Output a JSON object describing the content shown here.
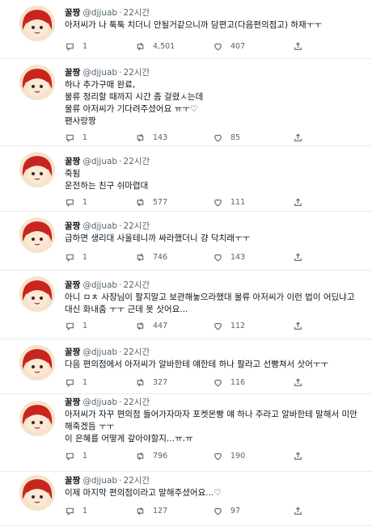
{
  "author": {
    "name": "꿀짱",
    "handle": "@djjuab",
    "time": "22시간"
  },
  "icons": {
    "reply": "reply-icon",
    "retweet": "retweet-icon",
    "like": "heart-icon",
    "share": "share-icon"
  },
  "colors": {
    "muted": "#536471",
    "divider": "#e6ecf0",
    "thread": "#cfd9de",
    "avatar_hair": "#c8251f"
  },
  "tweets": [
    {
      "text": "아저씨가 나 툭툭 치더니 안될거같으니까 담편고(다음편의점고) 하재ㅜㅜ",
      "replies": "1",
      "retweets": "4,501",
      "likes": "407"
    },
    {
      "text": "하나 추가구매 완료,\n물류 정리할 때까지 시간 좀 걸렸ㅅ는데\n물류 아저씨가 기다려주셨어요 ㅠㅜ♡\n팬사랑짱",
      "replies": "1",
      "retweets": "143",
      "likes": "85"
    },
    {
      "text": "죽됨\n운전하는 친구 쉬마렵대",
      "replies": "1",
      "retweets": "577",
      "likes": "111"
    },
    {
      "text": "급하면 생리대 사올테니까 싸라했더니 걍 닥치래ㅜㅜ",
      "replies": "1",
      "retweets": "746",
      "likes": "143"
    },
    {
      "text": "아니 ㅁㅊ 사장님이 팔지말고 보관해놓으라했대 물류 아저씨가 이런 법이 어딨냐고 대신 화내줌 ㅜㅜ 근데 못 삿어요...",
      "replies": "1",
      "retweets": "447",
      "likes": "112"
    },
    {
      "text": "다음 편의점에서 아저씨가 알바한테 얘한테 하나 팔라고 선빵쳐서 삿어ㅜㅜ",
      "replies": "1",
      "retweets": "327",
      "likes": "116"
    },
    {
      "text": "아저씨가 자꾸 편의점 들어가자마자 포켓몬빵 얘 하나 주라고 알바한테 말해서 미안해죽겠듬 ㅜㅜ\n이 은혜를 어떻게 갚아야할지...ㅠ.ㅠ",
      "replies": "1",
      "retweets": "796",
      "likes": "190"
    },
    {
      "text": "이제 마지막 편의점이라고 말해주셨어요...♡",
      "replies": "1",
      "retweets": "127",
      "likes": "97"
    }
  ]
}
